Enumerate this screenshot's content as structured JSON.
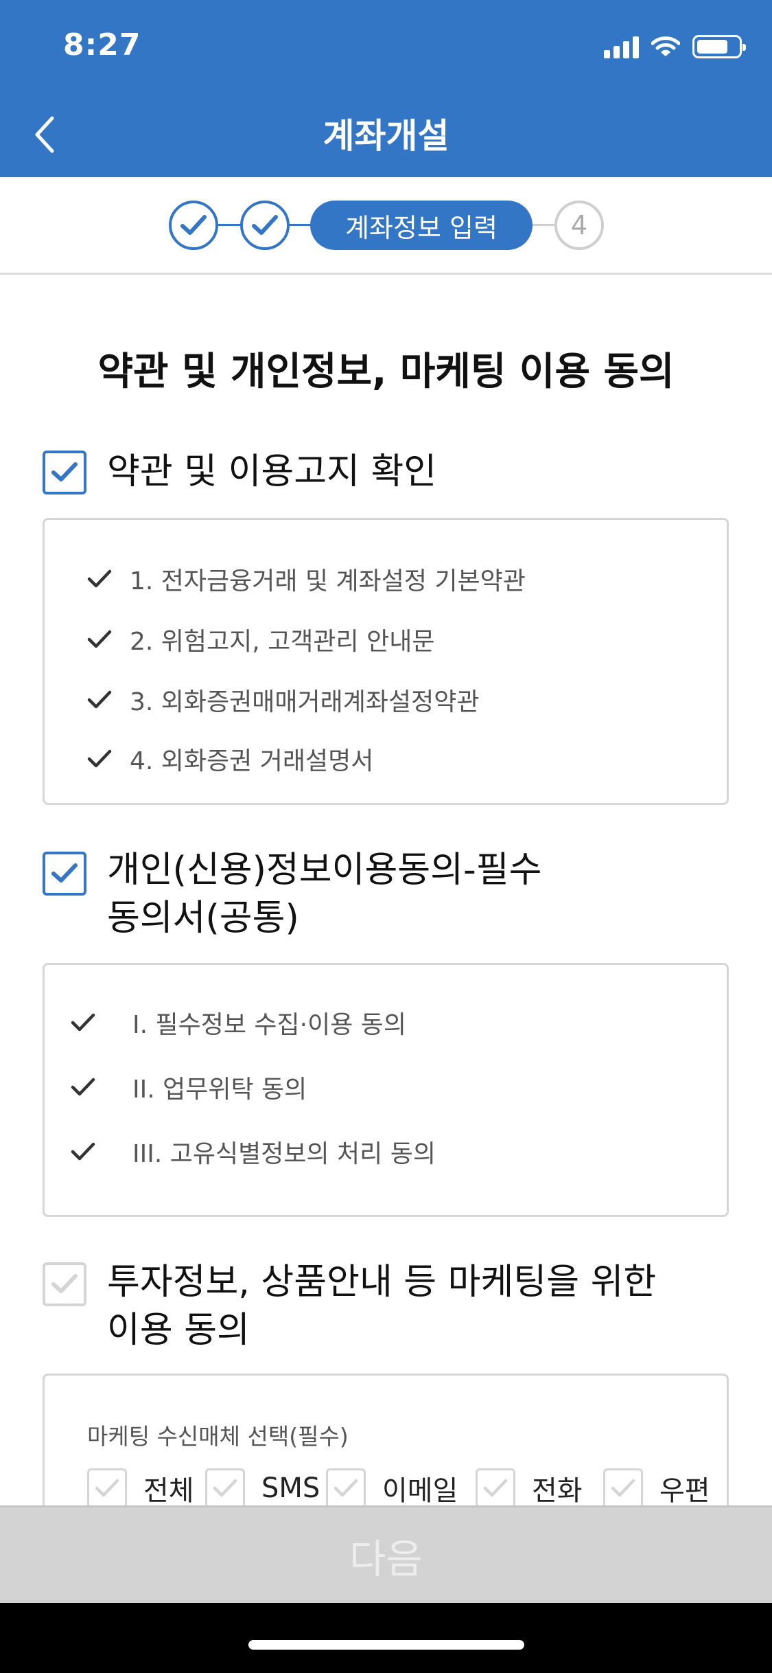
{
  "status_bar": {
    "time": "8:27"
  },
  "header": {
    "title": "계좌개설"
  },
  "steps": {
    "active_label": "계좌정보 입력",
    "future_number": "4"
  },
  "page_title": "약관 및 개인정보, 마케팅 이용 동의",
  "sections": [
    {
      "title": "약관 및 이용고지 확인",
      "checked": true,
      "items": [
        "1. 전자금융거래 및 계좌설정 기본약관",
        "2. 위험고지, 고객관리 안내문",
        "3. 외화증권매매거래계좌설정약관",
        "4. 외화증권 거래설명서"
      ]
    },
    {
      "title_line1": "개인(신용)정보이용동의-필수",
      "title_line2": "동의서(공통)",
      "checked": true,
      "items": [
        "I. 필수정보 수집·이용 동의",
        "II. 업무위탁 동의",
        "III. 고유식별정보의 처리 동의"
      ]
    },
    {
      "title_line1": "투자정보, 상품안내 등 마케팅을 위한",
      "title_line2": "이용 동의",
      "checked": false,
      "media_label": "마케팅 수신매체 선택(필수)",
      "options": [
        "전체",
        "SMS",
        "이메일",
        "전화",
        "우편"
      ]
    }
  ],
  "bottom_button": "다음",
  "colors": {
    "primary": "#3376c6",
    "disabled": "#d3d3d3",
    "border": "#d6d6d6"
  },
  "icons": [
    "back-icon",
    "signal-icon",
    "wifi-icon",
    "battery-icon",
    "check-icon"
  ]
}
